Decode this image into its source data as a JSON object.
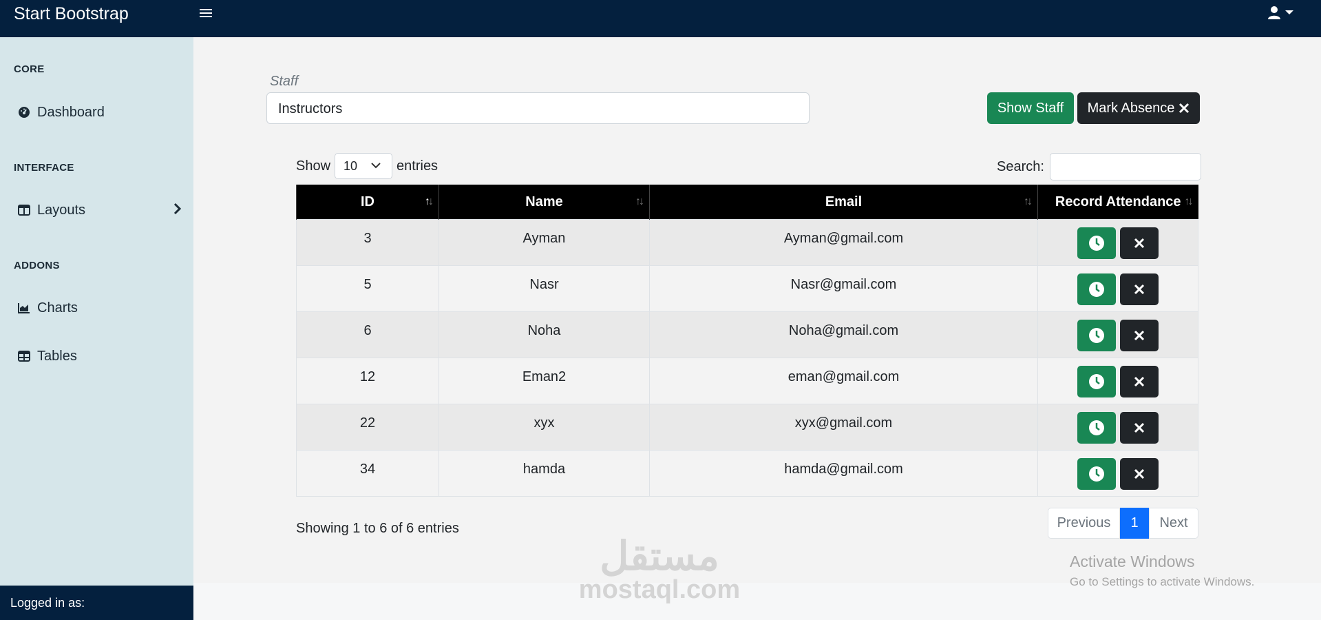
{
  "navbar": {
    "brand": "Start Bootstrap"
  },
  "sidebar": {
    "sections": [
      {
        "heading": "CORE"
      },
      {
        "heading": "INTERFACE"
      },
      {
        "heading": "ADDONS"
      }
    ],
    "items": [
      {
        "label": "Dashboard",
        "icon": "tachometer-icon"
      },
      {
        "label": "Layouts",
        "icon": "columns-icon"
      },
      {
        "label": "Charts",
        "icon": "chart-area-icon"
      },
      {
        "label": "Tables",
        "icon": "table-icon"
      }
    ],
    "footer": "Logged in as:"
  },
  "form": {
    "staff_label": "Staff",
    "staff_value": "Instructors",
    "show_staff_label": "Show Staff",
    "mark_absence_label": "Mark Absence"
  },
  "datatable": {
    "length_prefix": "Show",
    "length_value": "10",
    "length_suffix": "entries",
    "search_label": "Search:",
    "columns": [
      "ID",
      "Name",
      "Email",
      "Record Attendance"
    ],
    "rows": [
      {
        "id": "3",
        "name": "Ayman",
        "email": "Ayman@gmail.com"
      },
      {
        "id": "5",
        "name": "Nasr",
        "email": "Nasr@gmail.com"
      },
      {
        "id": "6",
        "name": "Noha",
        "email": "Noha@gmail.com"
      },
      {
        "id": "12",
        "name": "Eman2",
        "email": "eman@gmail.com"
      },
      {
        "id": "22",
        "name": "xyx",
        "email": "xyx@gmail.com"
      },
      {
        "id": "34",
        "name": "hamda",
        "email": "hamda@gmail.com"
      }
    ],
    "info": "Showing 1 to 6 of 6 entries",
    "pagination": {
      "previous": "Previous",
      "current": "1",
      "next": "Next"
    }
  },
  "overlays": {
    "watermark_ar": "مستقل",
    "watermark_en": "mostaql.com",
    "activate_title": "Activate Windows",
    "activate_sub": "Go to Settings to activate Windows."
  },
  "colors": {
    "navbar": "#04203e",
    "sidebar": "#d6e6ea",
    "success": "#198754",
    "dark": "#212529",
    "primary": "#0d6efd"
  }
}
